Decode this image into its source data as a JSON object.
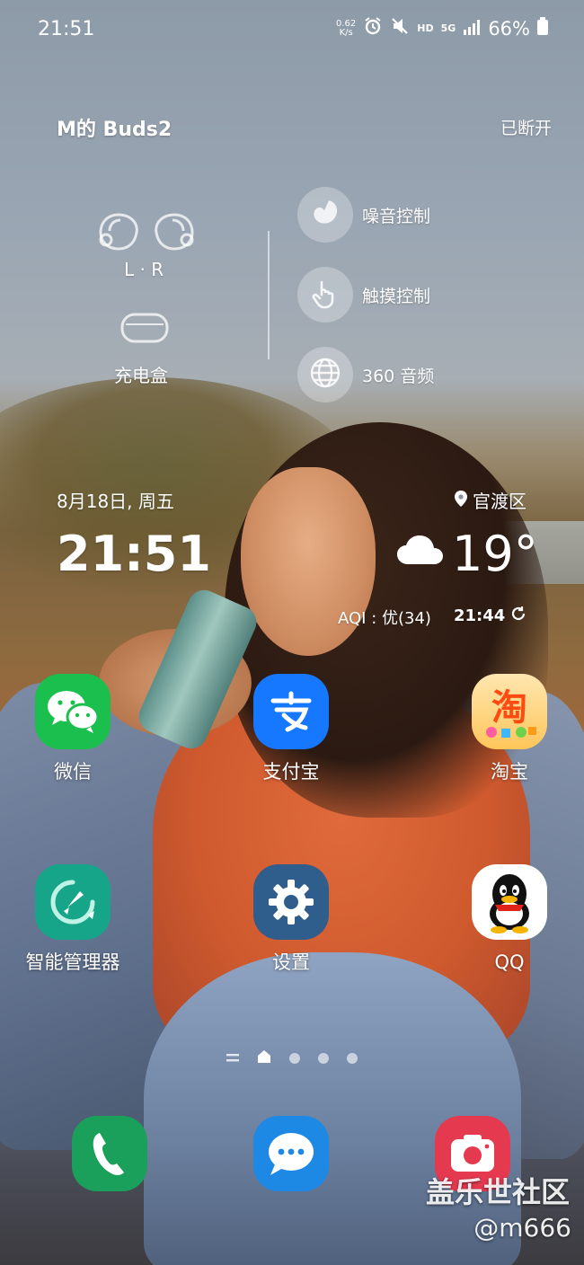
{
  "status_bar": {
    "time": "21:51",
    "net_speed_value": "0.62",
    "net_speed_unit": "K/s",
    "icons": [
      "alarm-icon",
      "mute-icon",
      "hd-icon",
      "5g-icon",
      "signal-icon",
      "battery-icon"
    ],
    "hd": "HD",
    "network": "5G",
    "battery": "66%"
  },
  "buds_widget": {
    "device_name": "M的 Buds2",
    "connection_status": "已断开",
    "earbuds_label": "L · R",
    "case_label": "充电盒",
    "controls": [
      {
        "label": "噪音控制",
        "icon": "noise-control-icon"
      },
      {
        "label": "触摸控制",
        "icon": "touch-control-icon"
      },
      {
        "label": "360 音频",
        "icon": "360-audio-icon"
      }
    ]
  },
  "clock_weather_widget": {
    "date": "8月18日, 周五",
    "location": "官渡区",
    "time": "21:51",
    "temperature": "19°",
    "aqi": "AQI : 优(34)",
    "updated_time": "21:44"
  },
  "home_apps": [
    {
      "name": "微信",
      "icon": "wechat-icon"
    },
    {
      "name": "支付宝",
      "icon": "alipay-icon"
    },
    {
      "name": "淘宝",
      "icon": "taobao-icon"
    },
    {
      "name": "智能管理器",
      "icon": "device-care-icon"
    },
    {
      "name": "设置",
      "icon": "settings-icon"
    },
    {
      "name": "QQ",
      "icon": "qq-icon"
    }
  ],
  "page_indicator": {
    "pages": 3,
    "current": "home"
  },
  "dock": [
    {
      "name": "phone",
      "icon": "phone-icon"
    },
    {
      "name": "messages",
      "icon": "messages-icon"
    },
    {
      "name": "camera",
      "icon": "camera-icon"
    }
  ],
  "watermark": {
    "line1": "盖乐世社区",
    "line2": "@m666"
  },
  "colors": {
    "wechat": "#1bbf4e",
    "alipay": "#1677ff",
    "device_care": "#17a58a",
    "settings": "#2f5d8c",
    "phone": "#1aa05a",
    "messages": "#1e88e5",
    "camera": "#e53950"
  }
}
